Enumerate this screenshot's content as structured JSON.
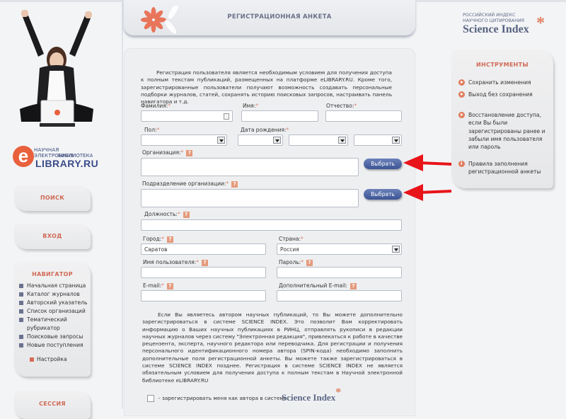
{
  "header": {
    "title": "РЕГИСТРАЦИОННАЯ АНКЕТА"
  },
  "brand": {
    "elibrary_line1": "НАУЧНАЯ ЭЛЕКТРОННАЯ",
    "elibrary_line2": "БИБЛИОТЕКА",
    "elibrary_name": "LIBRARY.RU",
    "elibrary_e": "e",
    "rinc_line1": "РОССИЙСКИЙ ИНДЕКС",
    "rinc_line2": "НАУЧНОГО ЦИТИРОВАНИЯ",
    "rinc_name": "Science Index",
    "star": "*"
  },
  "sidebar": {
    "search_label": "ПОИСК",
    "login_label": "ВХОД",
    "navigator": {
      "title": "НАВИГАТОР",
      "items": [
        {
          "label": "Начальная страница"
        },
        {
          "label": "Каталог журналов"
        },
        {
          "label": "Авторский указатель"
        },
        {
          "label": "Список организаций"
        },
        {
          "label": "Тематический рубрикатор"
        },
        {
          "label": "Поисковые запросы"
        },
        {
          "label": "Новые поступления"
        }
      ],
      "settings_label": "Настройка"
    },
    "session_label": "СЕССИЯ"
  },
  "form": {
    "intro": "Регистрация пользователя является необходимым условием для получения доступа к полным текстам публикаций, размещенных на платформе eLIBRARY.RU. Кроме того, зарегистрированные пользователи получают возможность создавать персональные подборки журналов, статей, сохранять историю поисковых запросов, настраивать панель навигатора и т.д.",
    "required_mark": "*",
    "help_mark": "?",
    "fields": {
      "last_name": {
        "label": "Фамилия:",
        "value": ""
      },
      "first_name": {
        "label": "Имя:",
        "value": ""
      },
      "patronymic": {
        "label": "Отчество:",
        "value": ""
      },
      "gender": {
        "label": "Пол:",
        "value": ""
      },
      "birth_date": {
        "label": "Дата рождения:",
        "day": "",
        "month": "",
        "year": ""
      },
      "organization": {
        "label": "Организация:",
        "value": ""
      },
      "department": {
        "label": "Подразделение организации:",
        "value": ""
      },
      "position": {
        "label": "Должность:",
        "value": ""
      },
      "city": {
        "label": "Город:",
        "value": "Саратов"
      },
      "country": {
        "label": "Страна:",
        "value": "Россия"
      },
      "username": {
        "label": "Имя пользователя:",
        "value": ""
      },
      "password": {
        "label": "Пароль:",
        "value": ""
      },
      "email": {
        "label": "E-mail:",
        "value": ""
      },
      "extra_email": {
        "label": "Дополнительный E-mail:",
        "value": ""
      }
    },
    "pick_button_label": "Выбрать",
    "science_index_text": "Если Вы являетесь автором научных публикаций, то Вы можете дополнительно зарегистрироваться в системе SCIENCE INDEX. Это позволит Вам корректировать информацию о Ваших научных публикациях в РИНЦ, отправлять рукописи в редакции научных журналов через систему \"Электронная редакция\", привлекаться к работе в качестве рецензента, эксперта, научного редактора или переводчика. Для регистрации и получения персонального идентификационного номера автора (SPIN-кода) необходимо заполнить дополнительные поля регистрационной анкеты. Вы можете также зарегистрироваться в системе SCIENCE INDEX позднее. Регистрация в системе SCIENCE INDEX не является обязательным условием для получения доступа к полным текстам в Научной электронной библиотеке eLIBRARY.RU",
    "register_author_label": "- зарегистрировать меня как автора в системе",
    "register_author_checked": false,
    "science_index_logo": "Science Index"
  },
  "tools": {
    "title": "ИНСТРУМЕНТЫ",
    "items": [
      {
        "label": "Сохранить изменения",
        "icon": "play-icon"
      },
      {
        "label": "Выход без сохранения",
        "icon": "play-icon"
      },
      {
        "label": "Восстановление доступа, если Вы были зарегистрированы ранее и забыли имя пользователя или пароль",
        "icon": "play-icon"
      },
      {
        "label": "Правила заполнения регистрационной анкеты",
        "icon": "info-icon"
      }
    ]
  },
  "annotations": {
    "arrow_color": "#e8141a"
  }
}
